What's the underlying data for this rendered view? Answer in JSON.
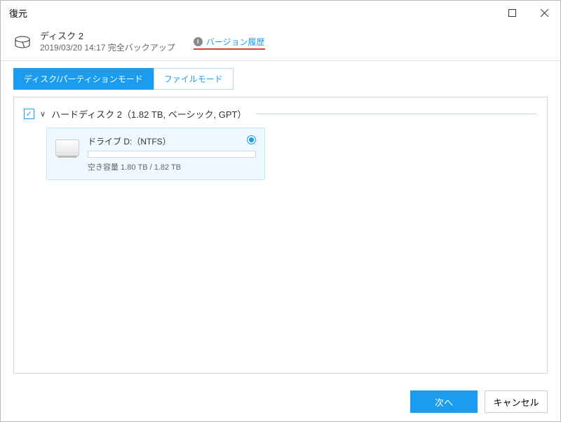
{
  "window": {
    "title": "復元"
  },
  "header": {
    "disk_title": "ディスク 2",
    "backup_meta": "2019/03/20 14:17 完全バックアップ",
    "version_link": "バージョン履歴",
    "info_glyph": "i"
  },
  "tabs": {
    "disk_mode": "ディスク/パーティションモード",
    "file_mode": "ファイルモード"
  },
  "disk": {
    "label": "ハードディスク 2（1.82 TB, ベーシック, GPT）",
    "check_glyph": "✓",
    "chev_glyph": "∨"
  },
  "drive": {
    "name": "ドライブ D:（NTFS）",
    "space": "空き容量 1.80 TB / 1.82 TB"
  },
  "footer": {
    "next": "次へ",
    "cancel": "キャンセル"
  }
}
